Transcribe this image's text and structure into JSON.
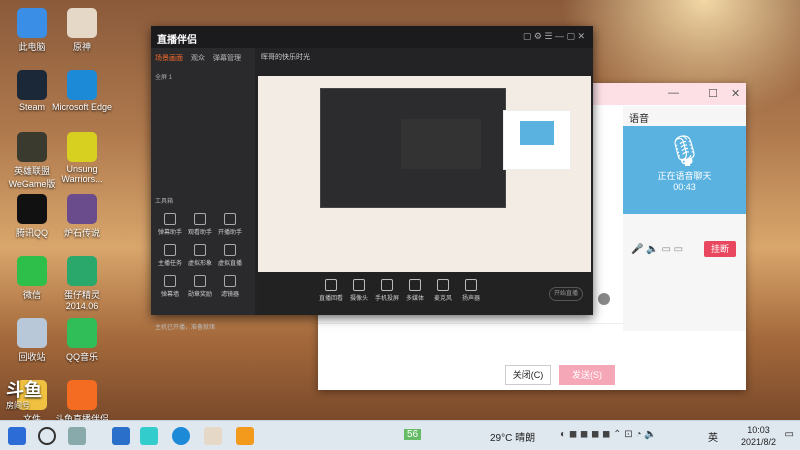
{
  "desktop": {
    "icons": [
      {
        "label": "此电脑",
        "icon": "computer-icon",
        "color": "#3a8ee6"
      },
      {
        "label": "原神",
        "icon": "genshin-icon",
        "color": "#e6d8c6"
      },
      {
        "label": "Steam",
        "icon": "steam-icon",
        "color": "#1b2838"
      },
      {
        "label": "Microsoft Edge",
        "icon": "edge-icon",
        "color": "#1d8ad8"
      },
      {
        "label": "英雄联盟 WeGame版",
        "icon": "lol-icon",
        "color": "#3b3a2e"
      },
      {
        "label": "Unsung Warriors...",
        "icon": "unsung-warriors-icon",
        "color": "#d8d020"
      },
      {
        "label": "腾讯QQ",
        "icon": "qq-icon",
        "color": "#111"
      },
      {
        "label": "炉石传说",
        "icon": "hearthstone-icon",
        "color": "#6a4c8c"
      },
      {
        "label": "微信",
        "icon": "wechat-icon",
        "color": "#2dbf4a"
      },
      {
        "label": "蛋仔精灵 2014.06",
        "icon": "app-icon",
        "color": "#2aa86b"
      },
      {
        "label": "回收站",
        "icon": "recycle-bin-icon",
        "color": "#b8c8d8"
      },
      {
        "label": "QQ音乐",
        "icon": "qqmusic-icon",
        "color": "#2fbe58"
      },
      {
        "label": "文件",
        "icon": "folder-icon",
        "color": "#f0c040"
      },
      {
        "label": "斗鱼直播伴侣",
        "icon": "douyu-icon",
        "color": "#f36c21"
      }
    ]
  },
  "watermark": {
    "brand": "斗鱼",
    "sub": "房间号"
  },
  "live": {
    "logo": "直播伴侣",
    "title": "晖哥的快乐时光",
    "tabs": [
      "场景画面",
      "观众",
      "弹幕管理"
    ],
    "scene": "全屏 1",
    "tools_label": "工具箱",
    "tools": [
      "弹幕助手",
      "观看助手",
      "开播助手",
      "主播任务",
      "虚拟形象",
      "虚拟直播",
      "弹幕墙",
      "勋章奖励",
      "滤镜器"
    ],
    "notice": "主机已开播，准备就绪",
    "bottom": [
      "直播回看",
      "摄像头",
      "手机投屏",
      "多媒体",
      "麦克风",
      "扬声器"
    ],
    "start": "开始直播"
  },
  "chat": {
    "voice_label": "语音",
    "status": "正在语音聊天",
    "time": "00:43",
    "hangup": "挂断",
    "close": "关闭(C)",
    "send": "发送(S)"
  },
  "taskbar": {
    "weather": "29°C 晴朗",
    "ime": "英",
    "time": "10:03",
    "date": "2021/8/2",
    "badge": "56"
  }
}
